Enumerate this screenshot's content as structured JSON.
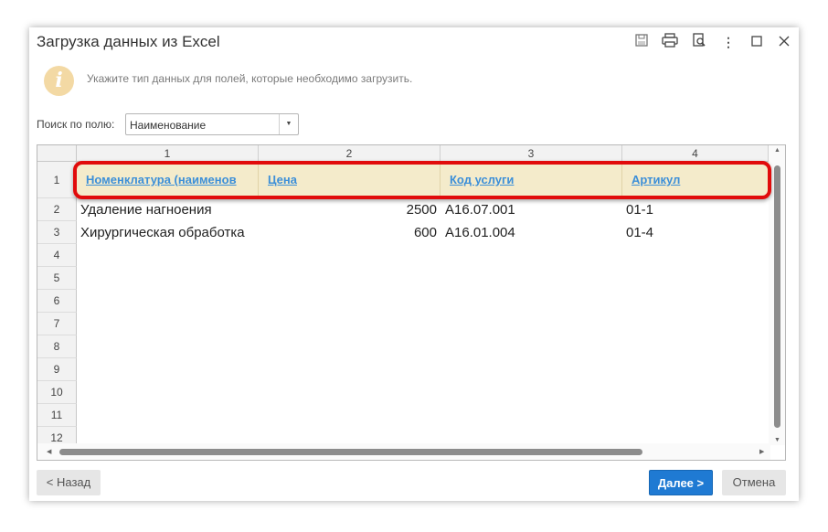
{
  "window": {
    "title": "Загрузка данных из Excel",
    "buttons": [
      "save-icon",
      "print-icon",
      "preview-icon",
      "more-icon",
      "maximize-icon",
      "close-icon"
    ]
  },
  "info": {
    "icon": "i",
    "text": "Укажите тип данных для полей, которые необходимо загрузить."
  },
  "search": {
    "label": "Поиск по полю:",
    "value": "Наименование"
  },
  "table": {
    "column_numbers": [
      "1",
      "2",
      "3",
      "4"
    ],
    "header_row_number": "1",
    "field_headers": [
      "Номенклатура (наименов",
      "Цена",
      "Код услуги",
      "Артикул"
    ],
    "rows": [
      {
        "num": "2",
        "name": "Удаление нагноения",
        "price": "2500",
        "code": "A16.07.001",
        "article": "01-1"
      },
      {
        "num": "3",
        "name": "Хирургическая обработка",
        "price": "600",
        "code": "A16.01.004",
        "article": "01-4"
      }
    ],
    "empty_row_numbers": [
      "4",
      "5",
      "6",
      "7",
      "8",
      "9",
      "10",
      "11",
      "12"
    ],
    "highlight_color": "#e10b0b"
  },
  "footer": {
    "back_label": "< Назад",
    "next_label": "Далее >",
    "cancel_label": "Отмена"
  }
}
